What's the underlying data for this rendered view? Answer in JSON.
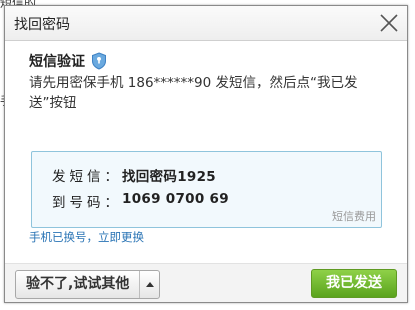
{
  "background": {
    "fragment_top": "短信的",
    "fragment_left": "手"
  },
  "dialog": {
    "title": "找回密码",
    "close_icon": "close-icon"
  },
  "content": {
    "heading": "短信验证",
    "shield_icon": "shield-icon",
    "instruction": "请先用密保手机 186******90 发短信，然后点“我已发送”按钮"
  },
  "sms_info": {
    "send_label": "发短信：",
    "send_value": "找回密码1925",
    "to_label": "到号码：",
    "to_value": "1069 0700 69",
    "fee_link": "短信费用"
  },
  "links": {
    "phone_changed": "手机已换号，立即更换"
  },
  "footer": {
    "alt_button": "验不了,试试其他",
    "dropdown_icon": "triangle-up-icon",
    "primary_button": "我已发送"
  },
  "colors": {
    "accent_blue": "#2a74b5",
    "box_border": "#8fc4dc",
    "box_bg": "#f2f9fd",
    "primary_green": "#6cb52a"
  }
}
